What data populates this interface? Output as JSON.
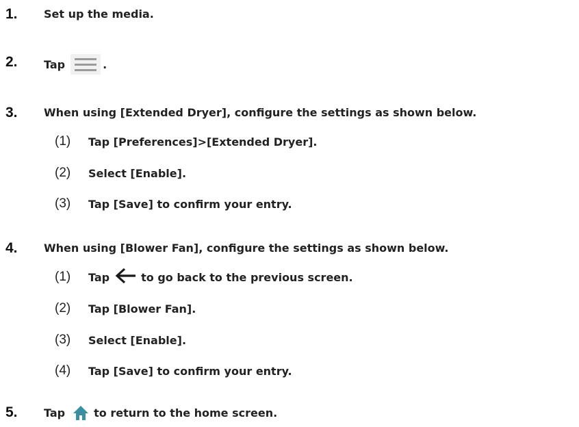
{
  "steps": [
    {
      "number": "1.",
      "text": "Set up the media."
    },
    {
      "number": "2.",
      "text_before": "Tap",
      "text_after": ".",
      "icon": "menu-icon"
    },
    {
      "number": "3.",
      "text": "When using [Extended Dryer], configure the settings as shown below.",
      "substeps": [
        {
          "number": "(1)",
          "text": "Tap [Preferences]>[Extended Dryer]."
        },
        {
          "number": "(2)",
          "text": "Select [Enable]."
        },
        {
          "number": "(3)",
          "text": "Tap [Save] to confirm your entry."
        }
      ]
    },
    {
      "number": "4.",
      "text": "When using [Blower Fan], configure the settings as shown below.",
      "substeps": [
        {
          "number": "(1)",
          "text_before": "Tap",
          "text_after": "to go back to the previous screen.",
          "icon": "back-arrow-icon"
        },
        {
          "number": "(2)",
          "text": "Tap [Blower Fan]."
        },
        {
          "number": "(3)",
          "text": "Select [Enable]."
        },
        {
          "number": "(4)",
          "text": "Tap [Save] to confirm your entry."
        }
      ]
    },
    {
      "number": "5.",
      "text_before": "Tap",
      "text_after": "to return to the home screen.",
      "icon": "home-icon"
    }
  ],
  "colors": {
    "home_icon": "#3a8fa0",
    "menu_bg": "#f1f1f1",
    "text": "#222222"
  }
}
